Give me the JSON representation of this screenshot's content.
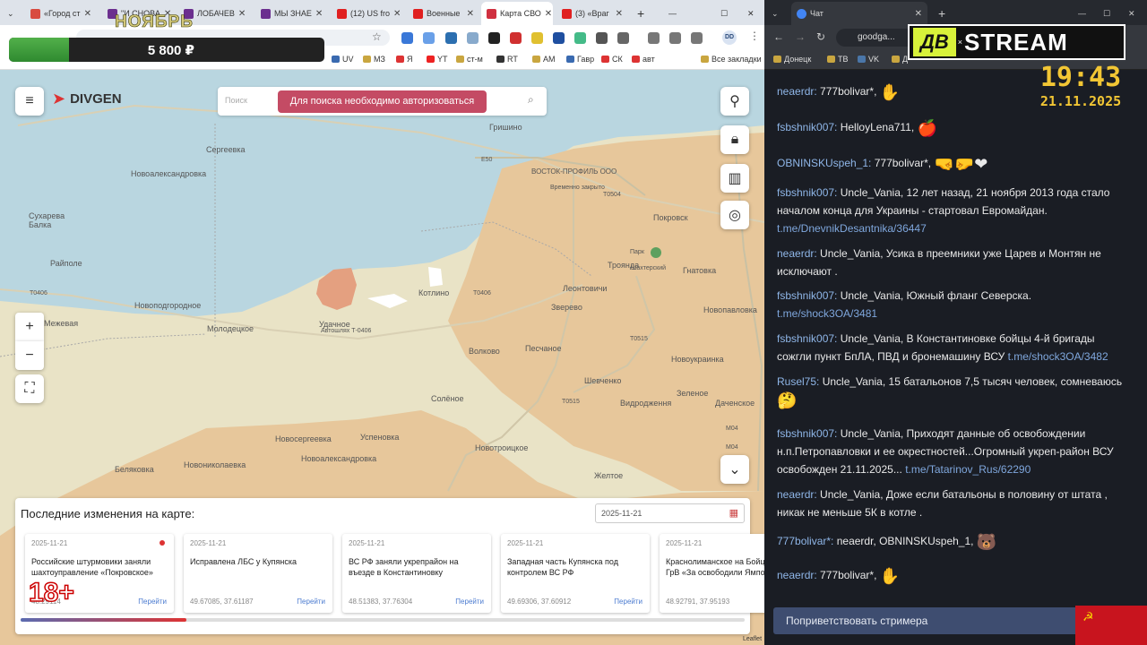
{
  "left_browser": {
    "tabs": [
      {
        "label": "«Город ст",
        "color": "#d84b40"
      },
      {
        "label": "\"И СНОВА",
        "color": "#6b2f8f"
      },
      {
        "label": "ЛОБАЧЕВ",
        "color": "#6b2f8f"
      },
      {
        "label": "МЫ ЗНАЕ",
        "color": "#6b2f8f"
      },
      {
        "label": "(12) US fro",
        "color": "#e02020"
      },
      {
        "label": "Военные",
        "color": "#e02020"
      },
      {
        "label": "Карта СВО",
        "color": "#d03040"
      },
      {
        "label": "(3) «Враг",
        "color": "#e02020"
      }
    ],
    "new_tab": "+",
    "bookmarks": [
      "UV",
      "МЗ",
      "Я",
      "YT",
      "ст-м",
      "RT",
      "AM",
      "Гавр",
      "СК",
      "авт"
    ],
    "all_bookmarks": "Все закладки",
    "avatar": "DD"
  },
  "overlay": {
    "month": "НОЯБРЬ",
    "amount": "5 800 ₽",
    "progress_fraction": 0.19,
    "age": "18+"
  },
  "map": {
    "brand": "DIVGEN",
    "search_placeholder": "Поиск",
    "auth_msg": "Для поиска необходимо авторизоваться",
    "labels": [
      "Гришино",
      "Сергеевка",
      "Новоалександровка",
      "Сухарева Балка",
      "Райполе",
      "Новоподгородное",
      "Межевая",
      "Молодецкое",
      "Удачное",
      "Котлино",
      "Леонтовичи",
      "Покровск",
      "Троянда",
      "Шахтерский",
      "Гнатовка",
      "Зверево",
      "Новопавловка",
      "Волково",
      "Песчаное",
      "Новоукраинка",
      "Шевченко",
      "Солёное",
      "Зеленое",
      "Видродження",
      "Даченское",
      "Новосергеевка",
      "Успеновка",
      "Новотроицкое",
      "Новониколаевка",
      "Новоалександровка",
      "Беляковка",
      "Желтое",
      "ВОСТОК-ПРОФИЛЬ ООО",
      "Временно закрыто",
      "Парк",
      "Автошлях Т-0406"
    ],
    "roads": [
      "E50",
      "T0504",
      "T0406",
      "T0406",
      "T0515",
      "T0515",
      "M04",
      "M04"
    ],
    "attribution": "Leaflet",
    "panel": {
      "title": "Последние изменения на карте:",
      "date": "2025-11-21",
      "cards": [
        {
          "date": "2025-11-21",
          "text": "Российские штурмовики заняли шахтоуправление «Покровское»",
          "coords": "48.29114",
          "go": "Перейти",
          "new": true
        },
        {
          "date": "2025-11-21",
          "text": "Исправлена ЛБС у Купянска",
          "coords": "49.67085, 37.61187",
          "go": "Перейти",
          "new": false
        },
        {
          "date": "2025-11-21",
          "text": "ВС РФ заняли укрепрайон на въезде в Константиновку",
          "coords": "48.51383, 37.76304",
          "go": "Перейти",
          "new": false
        },
        {
          "date": "2025-11-21",
          "text": "Западная часть Купянска под контролем ВС РФ",
          "coords": "49.69306, 37.60912",
          "go": "Перейти",
          "new": false
        },
        {
          "date": "2025-11-21",
          "text": "Краснолиманское на Бойцы 25 ОА ГрВ «За освободили Ямполь",
          "coords": "48.92791, 37.95193",
          "go": "Перейти",
          "new": false
        }
      ]
    }
  },
  "right_browser": {
    "tab": "Чат",
    "address": "goodga...",
    "bookmarks": [
      "Донецк",
      "ТВ",
      "VK",
      "Д"
    ],
    "stream_logo": "STREAM",
    "stream_logo_prefix": "ДВ",
    "time": "19:43",
    "date": "21.11.2025",
    "messages": [
      {
        "user": "neaerdr",
        "text": "777bolivar*,",
        "emoji": "✋"
      },
      {
        "user": "fsbshnik007",
        "text": "HelloyLena711,",
        "emoji": "🍎"
      },
      {
        "user": "OBNINSKUspeh_1",
        "text": "777bolivar*,",
        "emoji": "🤜🤛❤"
      },
      {
        "user": "fsbshnik007",
        "text": "Uncle_Vania, 12 лет назад, 21 ноября 2013 года стало началом конца для Украины - стартовал Евромайдан.",
        "link": "t.me/DnevnikDesantnika/36447"
      },
      {
        "user": "neaerdr",
        "text": "Uncle_Vania, Усика в преемники уже Царев и Монтян не исключают ."
      },
      {
        "user": "fsbshnik007",
        "text": "Uncle_Vania, Южный фланг Северска.",
        "link": "t.me/shock3OA/3481"
      },
      {
        "user": "fsbshnik007",
        "text": "Uncle_Vania, В Константиновке бойцы 4-й бригады сожгли пункт БпЛА, ПВД и бронемашину ВСУ",
        "link": "t.me/shock3OA/3482"
      },
      {
        "user": "Rusel75",
        "text": "Uncle_Vania, 15 батальонов 7,5 тысяч человек, сомневаюсь",
        "emoji": "🤔"
      },
      {
        "user": "fsbshnik007",
        "text": "Uncle_Vania, Приходят данные об освобождении н.п.Петропавловки и ее окрестностей...Огромный укреп-район ВСУ освобожден 21.11.2025...",
        "link": "t.me/Tatarinov_Rus/62290"
      },
      {
        "user": "neaerdr",
        "text": "Uncle_Vania, Доже если батальоны в половину от штата , никак не меньше 5К в котле ."
      },
      {
        "user": "777bolivar*",
        "text": "neaerdr, OBNINSKUspeh_1,",
        "emoji": "🐻"
      },
      {
        "user": "neaerdr",
        "text": "777bolivar*,",
        "emoji": "✋"
      }
    ],
    "greet_button": "Поприветствовать стримера"
  }
}
